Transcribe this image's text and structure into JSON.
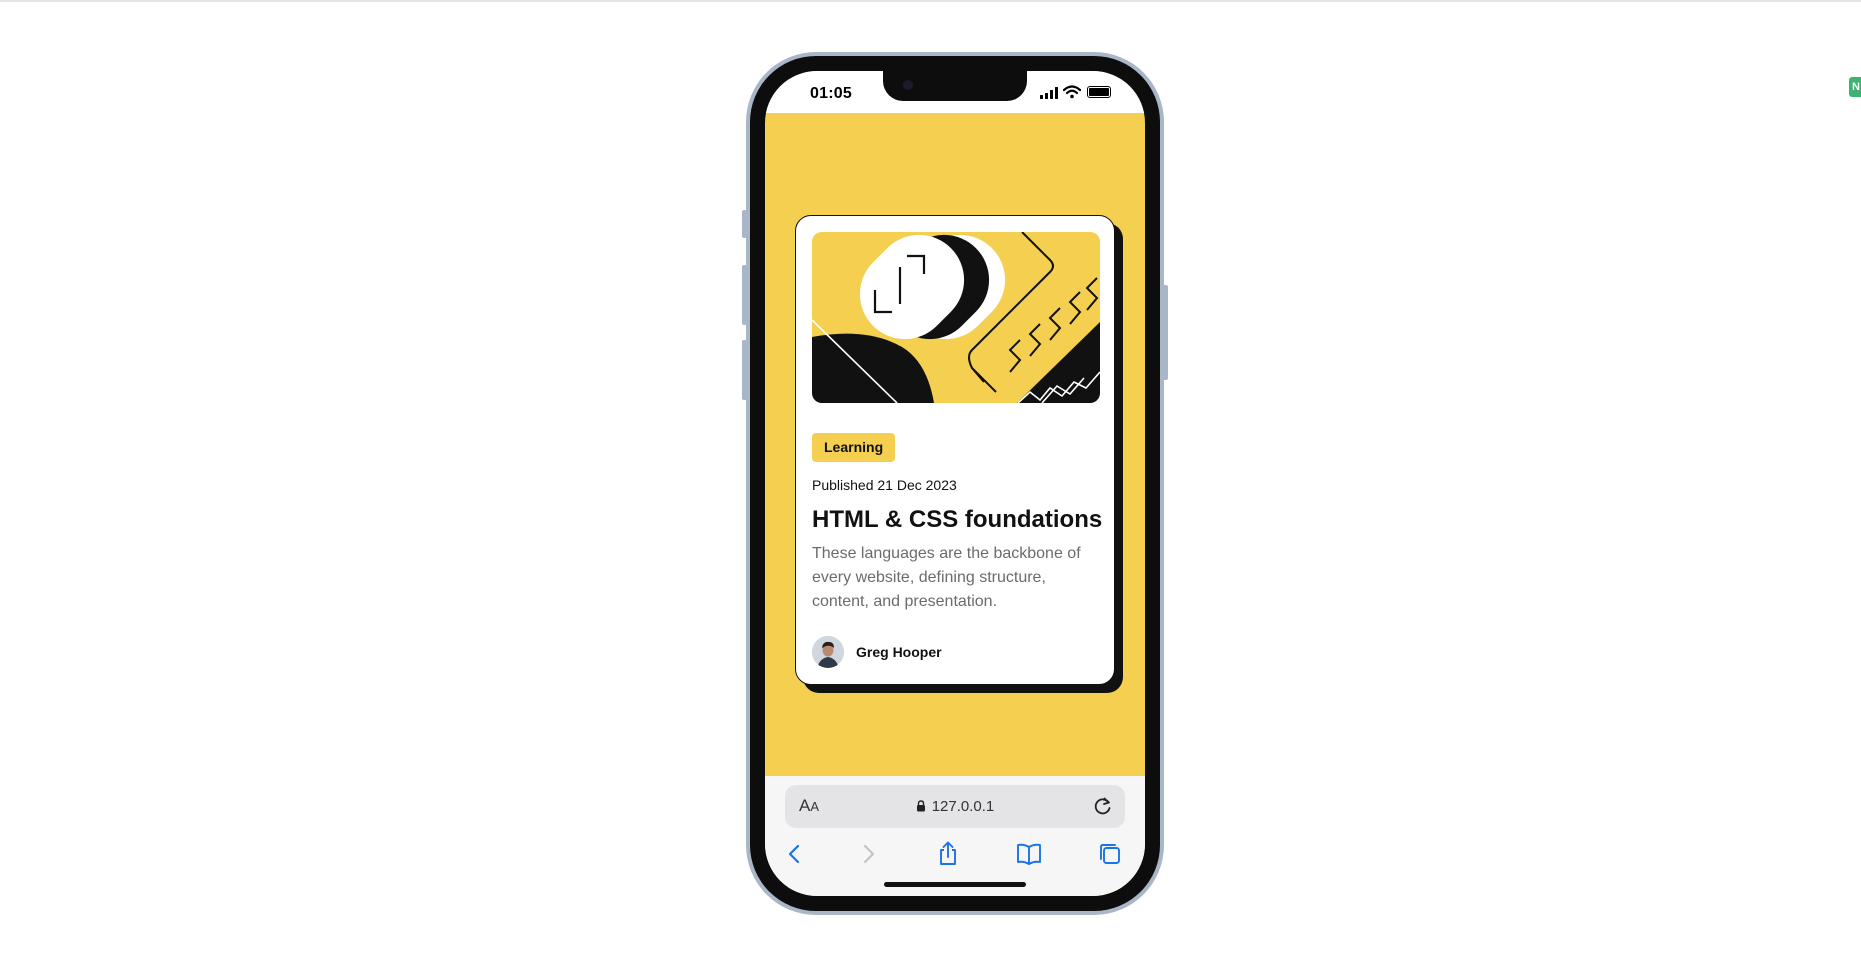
{
  "status": {
    "time": "01:05"
  },
  "card": {
    "tag": "Learning",
    "published": "Published 21 Dec 2023",
    "title": "HTML & CSS foundations",
    "description": "These languages are the backbone of every website, defining structure, content, and presentation.",
    "author": "Greg Hooper"
  },
  "browser": {
    "url": "127.0.0.1",
    "text_size_label": "AA"
  },
  "colors": {
    "accent": "#f4cf50",
    "ink": "#111111",
    "muted": "#6b6b6b",
    "link_blue": "#1a73e8"
  },
  "icons": [
    "signal-icon",
    "wifi-icon",
    "battery-icon",
    "lock-icon",
    "reload-icon",
    "back-icon",
    "forward-icon",
    "share-icon",
    "bookmarks-icon",
    "tabs-icon"
  ]
}
